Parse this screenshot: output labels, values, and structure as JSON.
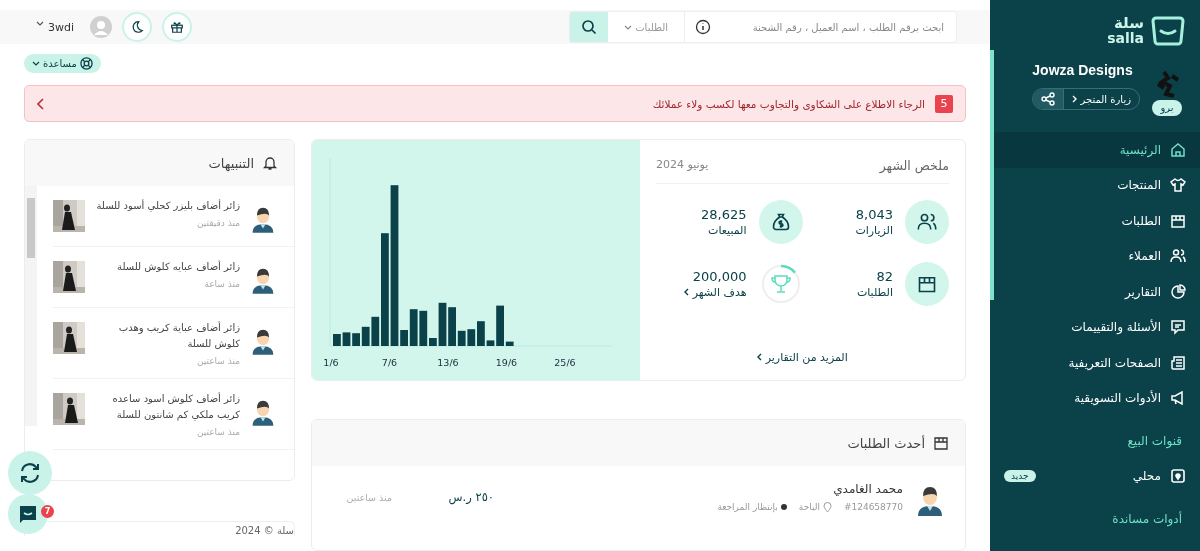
{
  "sidebar": {
    "logo_text": "سلة",
    "logo_latin": "salla",
    "store_name": "Jowza Designs",
    "plan_badge": "برو",
    "visit_store": "زيارة المتجر",
    "items": [
      {
        "label": "الرئيسية",
        "selected": true
      },
      {
        "label": "المنتجات",
        "selected": false
      },
      {
        "label": "الطلبات",
        "selected": false
      },
      {
        "label": "العملاء",
        "selected": false
      },
      {
        "label": "التقارير",
        "selected": false
      },
      {
        "label": "الأسئلة والتقييمات",
        "selected": false
      },
      {
        "label": "الصفحات التعريفية",
        "selected": false
      },
      {
        "label": "الأدوات التسويقية",
        "selected": false
      }
    ],
    "sections": [
      {
        "title": "قنوات البيع",
        "items": [
          {
            "label": "محلي",
            "badge": "جديد"
          }
        ]
      },
      {
        "title": "أدوات مساندة"
      }
    ]
  },
  "topbar": {
    "search": {
      "placeholder": "ابحث برقم الطلب ، اسم العميل ، رقم الشحنة"
    },
    "scope": "الطلبات",
    "user": "3wdi"
  },
  "help": "مساعدة",
  "alert": {
    "count": "5",
    "text": "الرجاء الاطلاع على الشكاوى والتجاوب معها لكسب ولاء عملائك"
  },
  "summary": {
    "title": "ملخص الشهر",
    "period": "يونيو 2024",
    "stats": [
      {
        "kind": "visits",
        "value": "8,043",
        "label": "الزيارات"
      },
      {
        "kind": "sales",
        "value": "28,625",
        "label": "المبيعات"
      },
      {
        "kind": "orders",
        "value": "82",
        "label": "الطلبات"
      },
      {
        "kind": "goal",
        "value": "200,000",
        "label": "هدف الشهر"
      }
    ],
    "more": "المزيد من التقارير",
    "chart_axis_labels": [
      "25/6",
      "19/6",
      "13/6",
      "7/6",
      "1/6"
    ]
  },
  "notifications": {
    "title": "التنبيهات",
    "items": [
      {
        "text": "زائر أضاف بليزر كحلي أسود للسلة",
        "time": "منذ دقيقتين"
      },
      {
        "text": "زائر أضاف عبايه كلوش للسلة",
        "time": "منذ ساعة"
      },
      {
        "text": "زائر أضاف عباية كريب وهدب كلوش للسلة",
        "time": "منذ ساعتين"
      },
      {
        "text": "زائر أضاف كلوش اسود ساعده كريب ملكي كم شانتون للسلة",
        "time": "منذ ساعتين"
      }
    ]
  },
  "chat_badge": "7",
  "footer": "سلة © 2024",
  "orders": {
    "title": "أحدث الطلبات",
    "rows": [
      {
        "customer": "محمد الغامدي",
        "number": "#124658770",
        "city": "الباحة",
        "status": "بإنتظار المراجعة",
        "color": "#333333",
        "amount": "٢٥٠ ر.س",
        "time": "منذ ساعتين"
      }
    ]
  }
}
